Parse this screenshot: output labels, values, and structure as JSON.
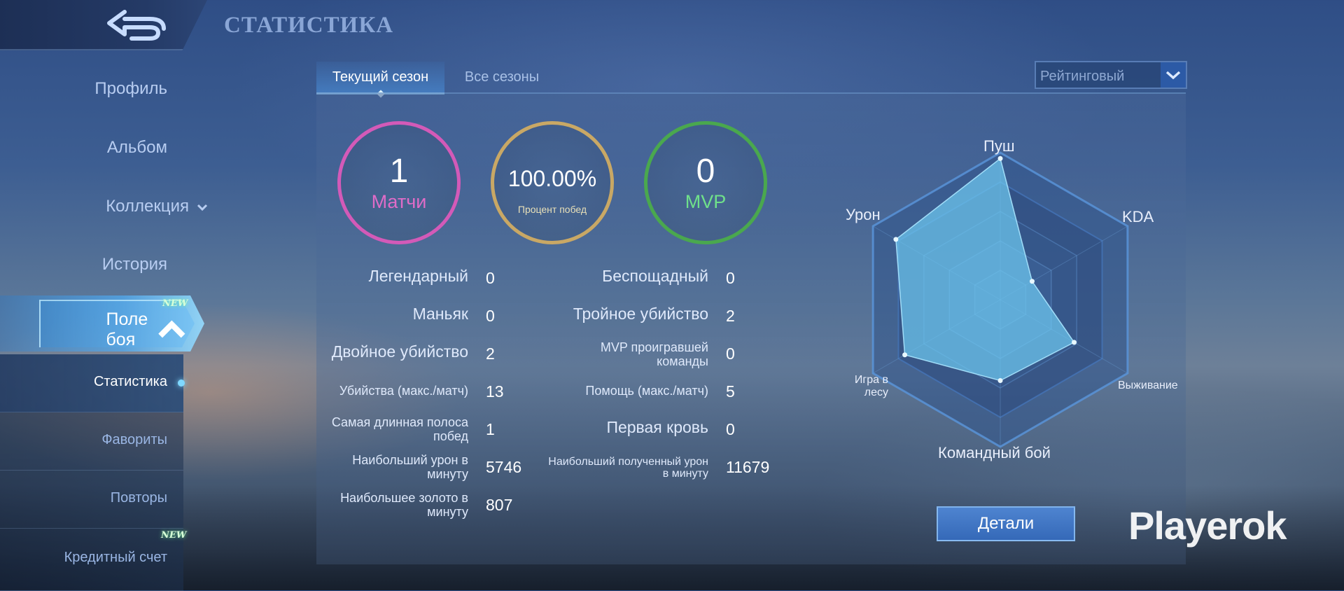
{
  "header": {
    "title": "СТАТИСТИКА"
  },
  "sidebar": {
    "items": [
      {
        "label": "Профиль"
      },
      {
        "label": "Альбом"
      },
      {
        "label": "Коллекция"
      },
      {
        "label": "История"
      },
      {
        "label": "Поле боя",
        "badge": "NEW"
      }
    ],
    "sub_items": [
      {
        "label": "Статистика"
      },
      {
        "label": "Фавориты"
      },
      {
        "label": "Повторы"
      },
      {
        "label": "Кредитный счет",
        "badge": "NEW"
      }
    ]
  },
  "tabs": [
    {
      "label": "Текущий сезон"
    },
    {
      "label": "Все сезоны"
    }
  ],
  "mode_select": {
    "value": "Рейтинговый"
  },
  "summary": {
    "matches": {
      "value": "1",
      "label": "Матчи",
      "color": "#d35ab8"
    },
    "winrate": {
      "value": "100.00%",
      "label": "Процент побед",
      "color": "#c9a865"
    },
    "mvp": {
      "value": "0",
      "label": "MVP",
      "color": "#4aa84e"
    }
  },
  "stats_left": [
    {
      "label": "Легендарный",
      "value": "0"
    },
    {
      "label": "Маньяк",
      "value": "0"
    },
    {
      "label": "Двойное убийство",
      "value": "2"
    },
    {
      "label": "Убийства (макс./матч)",
      "value": "13"
    },
    {
      "label": "Самая длинная полоса побед",
      "value": "1"
    },
    {
      "label": "Наибольший урон в минуту",
      "value": "5746"
    },
    {
      "label": "Наибольшее золото в минуту",
      "value": "807"
    }
  ],
  "stats_right": [
    {
      "label": "Беспощадный",
      "value": "0"
    },
    {
      "label": "Тройное убийство",
      "value": "2"
    },
    {
      "label": "MVP проигравшей команды",
      "value": "0"
    },
    {
      "label": "Помощь (макс./матч)",
      "value": "5"
    },
    {
      "label": "Первая кровь",
      "value": "0"
    },
    {
      "label": "Наибольший полученный урон в минуту",
      "value": "11679"
    }
  ],
  "radar": {
    "axes": [
      "Пуш",
      "KDA",
      "Выживание",
      "Командный бой",
      "Игра в лесу",
      "Урон"
    ],
    "values": [
      0.96,
      0.25,
      0.58,
      0.55,
      0.75,
      0.82
    ]
  },
  "details_button": {
    "label": "Детали"
  },
  "watermark": "Playerok",
  "colors": {
    "accent": "#7fd8ff",
    "button": "#3f76c4"
  }
}
